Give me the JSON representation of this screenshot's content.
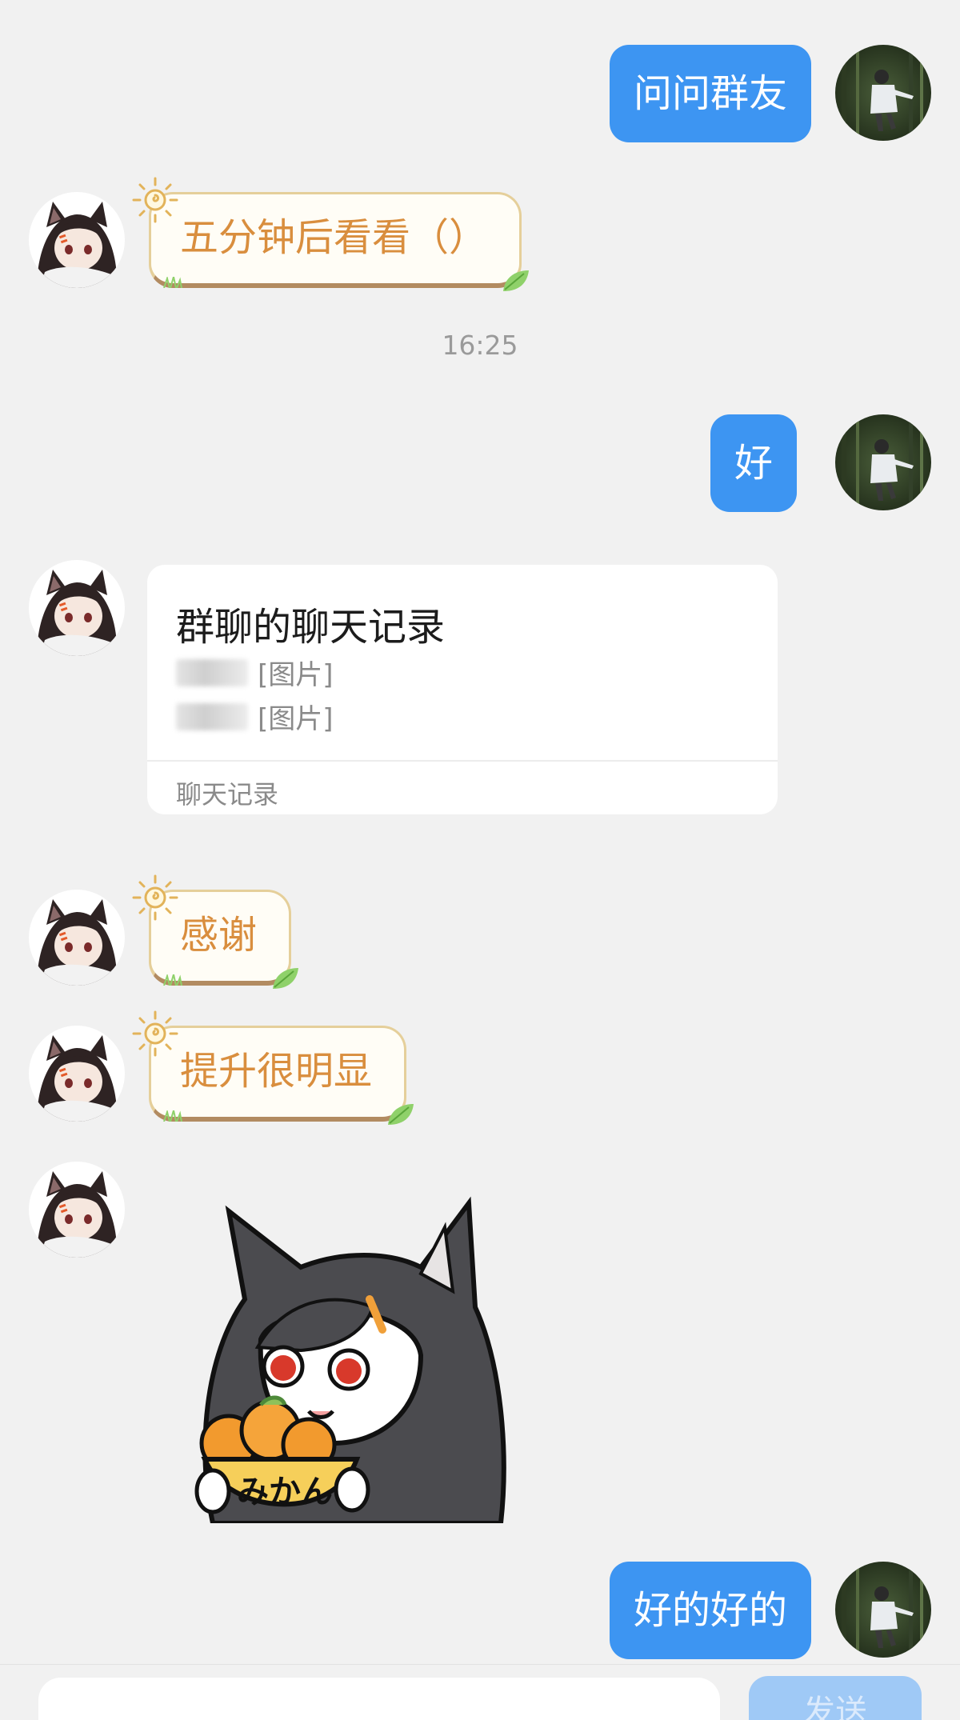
{
  "messages": {
    "m1": {
      "sender": "self",
      "text": "问问群友"
    },
    "m2": {
      "sender": "other",
      "text": "五分钟后看看（）"
    },
    "time1": "16:25",
    "m3": {
      "sender": "self",
      "text": "好"
    },
    "m4": {
      "sender": "other",
      "type": "forwarded_chat_record",
      "title": "群聊的聊天记录",
      "lines": [
        "[图片]",
        "[图片]"
      ],
      "footer": "聊天记录"
    },
    "m5": {
      "sender": "other",
      "text": "感谢"
    },
    "m6": {
      "sender": "other",
      "text": "提升很明显"
    },
    "m7": {
      "sender": "other",
      "type": "sticker",
      "sticker_text": "みかん"
    },
    "m8": {
      "sender": "self",
      "text": "好的好的"
    }
  },
  "input": {
    "placeholder": "",
    "send_label": "发送"
  },
  "colors": {
    "background": "#f1f1f1",
    "self_bubble": "#3d95f2",
    "theme_text": "#d98e3e",
    "theme_border": "#e5cf9a",
    "send_disabled": "#9fc9f6"
  },
  "icons": {
    "self_avatar": "person-in-forest-avatar",
    "other_avatar": "anime-cat-girl-avatar",
    "bubble_decor": "sun-icon",
    "bubble_leaf": "leaf-icon"
  }
}
